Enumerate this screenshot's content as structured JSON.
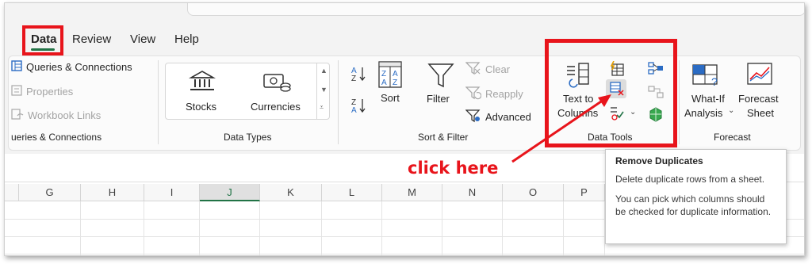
{
  "tabs": [
    {
      "label": "Data",
      "active": true
    },
    {
      "label": "Review"
    },
    {
      "label": "View"
    },
    {
      "label": "Help"
    }
  ],
  "queries": {
    "items": [
      "Queries & Connections",
      "Properties",
      "Workbook Links"
    ],
    "group_label": "ueries & Connections"
  },
  "data_types": {
    "stocks": "Stocks",
    "currencies": "Currencies",
    "group_label": "Data Types"
  },
  "sort_filter": {
    "sort": "Sort",
    "filter": "Filter",
    "clear": "Clear",
    "reapply": "Reapply",
    "advanced": "Advanced",
    "group_label": "Sort & Filter"
  },
  "data_tools": {
    "text_to_line1": "Text to",
    "text_to_line2": "Columns",
    "group_label": "Data Tools"
  },
  "forecast": {
    "what_if_line1": "What-If",
    "what_if_line2": "Analysis",
    "forecast_line1": "Forecast",
    "forecast_line2": "Sheet",
    "group_label": "Forecast"
  },
  "columns": [
    "G",
    "H",
    "I",
    "J",
    "K",
    "L",
    "M",
    "N",
    "O",
    "P"
  ],
  "selected_column": "J",
  "annotation": {
    "text": "click here",
    "color": "#e8141b"
  },
  "tooltip": {
    "title": "Remove Duplicates",
    "line1": "Delete duplicate rows from a sheet.",
    "line2": "You can pick which columns should be checked for duplicate information."
  },
  "colors": {
    "accent": "#217346",
    "highlight": "#e8141b"
  }
}
